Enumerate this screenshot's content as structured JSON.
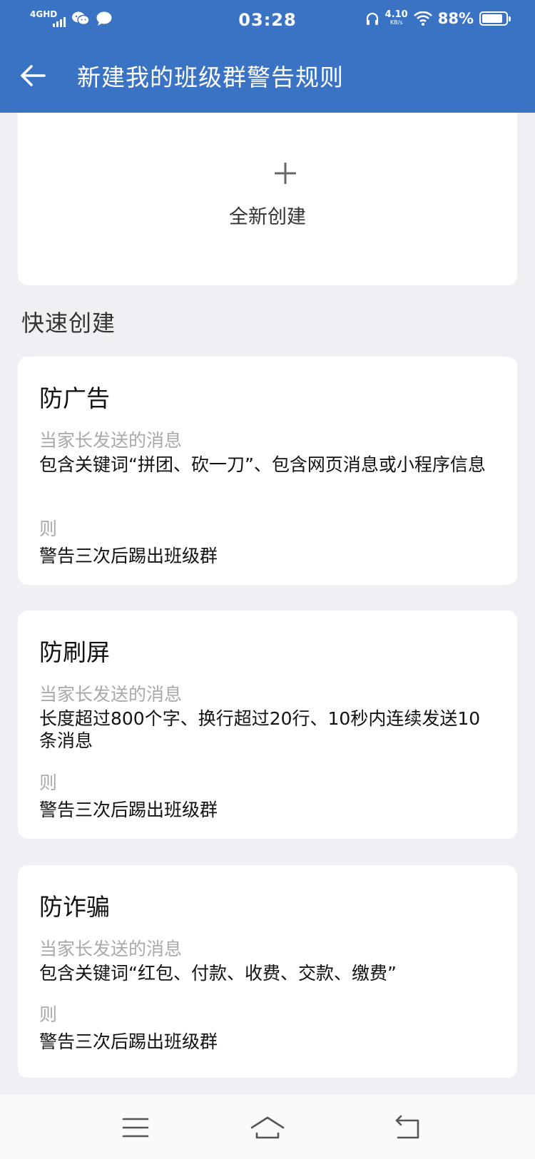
{
  "status_bar": {
    "network": "4GHD",
    "time": "03:28",
    "net_speed": "4.10",
    "net_speed_unit": "KB/s",
    "battery": "88%",
    "battery_level": 0.88,
    "icons": [
      "signal-icon",
      "wechat-icon",
      "message-icon",
      "headphone-icon",
      "wifi-icon",
      "battery-icon"
    ]
  },
  "header": {
    "title": "新建我的班级群警告规则"
  },
  "create": {
    "label": "全新创建"
  },
  "quick_create": {
    "section_title": "快速创建",
    "rules": [
      {
        "title": "防广告",
        "condition_label": "当家长发送的消息",
        "condition": "包含关键词“拼团、砍一刀”、包含网页消息或小程序信息",
        "then_label": "则",
        "action": "警告三次后踢出班级群"
      },
      {
        "title": "防刷屏",
        "condition_label": "当家长发送的消息",
        "condition": "长度超过800个字、换行超过20行、10秒内连续发送10条消息",
        "then_label": "则",
        "action": "警告三次后踢出班级群"
      },
      {
        "title": "防诈骗",
        "condition_label": "当家长发送的消息",
        "condition": "包含关键词“红包、付款、收费、交款、缴费”",
        "then_label": "则",
        "action": "警告三次后踢出班级群"
      }
    ]
  },
  "colors": {
    "header_bg": "#3b73c4",
    "page_bg": "#eef0f3",
    "card_bg": "#ffffff",
    "muted_text": "#a7a9ad"
  }
}
